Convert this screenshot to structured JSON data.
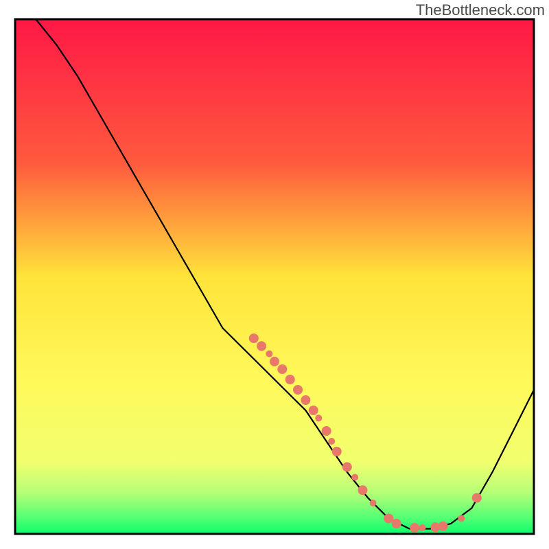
{
  "watermark": "TheBottleneck.com",
  "chart_data": {
    "type": "line",
    "title": "",
    "xlabel": "",
    "ylabel": "",
    "xlim": [
      0,
      100
    ],
    "ylim": [
      0,
      100
    ],
    "gradient_colors": {
      "top": "#ff1846",
      "upper_mid": "#ff7a3e",
      "mid": "#ffe33a",
      "lower_mid": "#fffb5d",
      "bottom_band": "#b6fe77",
      "bottom": "#0cff6c"
    },
    "curve": [
      {
        "x": 4,
        "y": 100
      },
      {
        "x": 8,
        "y": 95
      },
      {
        "x": 12,
        "y": 89
      },
      {
        "x": 16,
        "y": 82
      },
      {
        "x": 20,
        "y": 75
      },
      {
        "x": 24,
        "y": 68
      },
      {
        "x": 28,
        "y": 61
      },
      {
        "x": 32,
        "y": 54
      },
      {
        "x": 36,
        "y": 47
      },
      {
        "x": 40,
        "y": 40
      },
      {
        "x": 44,
        "y": 36
      },
      {
        "x": 48,
        "y": 32
      },
      {
        "x": 52,
        "y": 28
      },
      {
        "x": 56,
        "y": 24
      },
      {
        "x": 60,
        "y": 18
      },
      {
        "x": 64,
        "y": 12
      },
      {
        "x": 68,
        "y": 7
      },
      {
        "x": 72,
        "y": 3
      },
      {
        "x": 76,
        "y": 1
      },
      {
        "x": 80,
        "y": 1
      },
      {
        "x": 84,
        "y": 2
      },
      {
        "x": 88,
        "y": 5
      },
      {
        "x": 92,
        "y": 12
      },
      {
        "x": 96,
        "y": 20
      },
      {
        "x": 100,
        "y": 28
      }
    ],
    "marker_color": "#e8786a",
    "markers": [
      {
        "x": 46,
        "y": 38,
        "r": 7
      },
      {
        "x": 47.5,
        "y": 36.5,
        "r": 7
      },
      {
        "x": 49,
        "y": 35,
        "r": 5
      },
      {
        "x": 50,
        "y": 33.5,
        "r": 7
      },
      {
        "x": 51.5,
        "y": 32,
        "r": 7
      },
      {
        "x": 53,
        "y": 30,
        "r": 7
      },
      {
        "x": 54.5,
        "y": 28,
        "r": 7
      },
      {
        "x": 56,
        "y": 26,
        "r": 7
      },
      {
        "x": 57.5,
        "y": 24,
        "r": 7
      },
      {
        "x": 58.5,
        "y": 22.5,
        "r": 5
      },
      {
        "x": 60,
        "y": 20,
        "r": 7
      },
      {
        "x": 61,
        "y": 18,
        "r": 5
      },
      {
        "x": 62,
        "y": 16,
        "r": 7
      },
      {
        "x": 64,
        "y": 13,
        "r": 7
      },
      {
        "x": 65.5,
        "y": 11,
        "r": 5
      },
      {
        "x": 67,
        "y": 8.5,
        "r": 7
      },
      {
        "x": 69,
        "y": 6,
        "r": 5
      },
      {
        "x": 72,
        "y": 3,
        "r": 7
      },
      {
        "x": 73.5,
        "y": 2,
        "r": 7
      },
      {
        "x": 77,
        "y": 1.2,
        "r": 7
      },
      {
        "x": 78.5,
        "y": 1.2,
        "r": 5
      },
      {
        "x": 81,
        "y": 1.3,
        "r": 7
      },
      {
        "x": 82.5,
        "y": 1.5,
        "r": 7
      },
      {
        "x": 86,
        "y": 3,
        "r": 5
      },
      {
        "x": 89,
        "y": 7,
        "r": 7
      }
    ],
    "plot_border_color": "#000000",
    "plot_border_width": 3
  }
}
